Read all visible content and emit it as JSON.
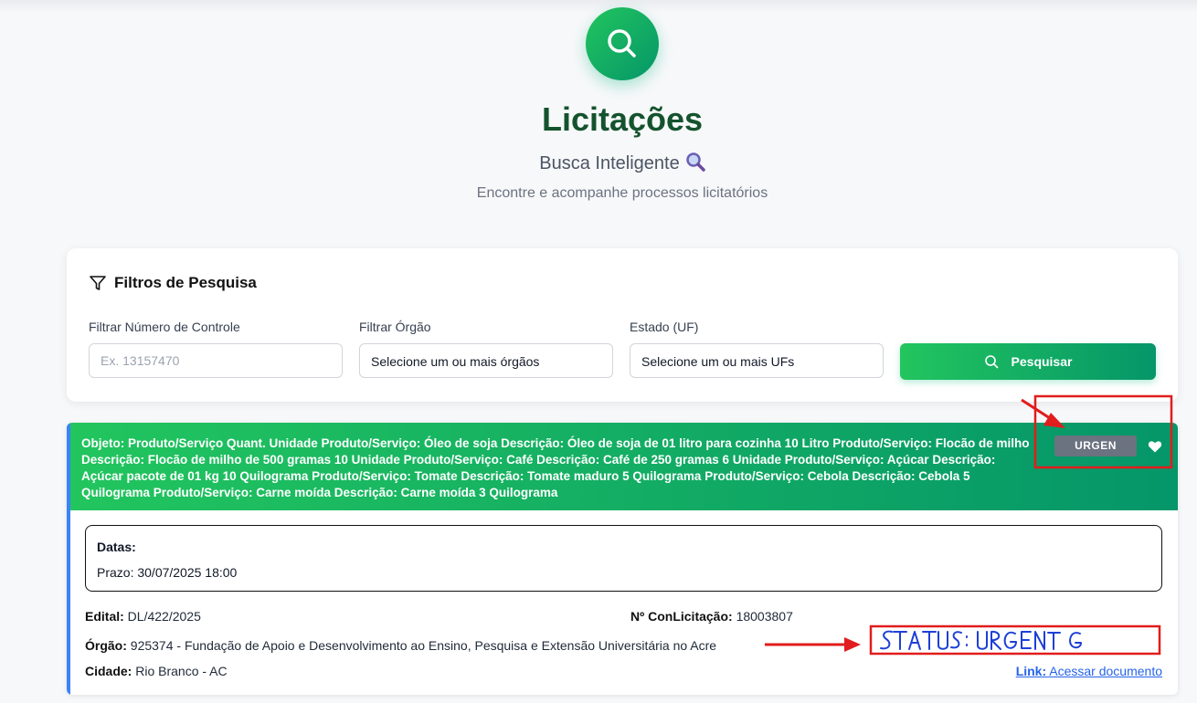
{
  "header": {
    "title": "Licitações",
    "subtitle": "Busca Inteligente",
    "description": "Encontre e acompanhe processos licitatórios"
  },
  "filters": {
    "title": "Filtros de Pesquisa",
    "controle_label": "Filtrar Número de Controle",
    "controle_placeholder": "Ex. 13157470",
    "orgao_label": "Filtrar Órgão",
    "orgao_value": "Selecione um ou mais órgãos",
    "uf_label": "Estado (UF)",
    "uf_value": "Selecione um ou mais UFs",
    "search_label": "Pesquisar"
  },
  "result": {
    "objeto_label": "Objeto:",
    "objeto_text": "Produto/Serviço Quant. Unidade Produto/Serviço: Óleo de soja Descrição: Óleo de soja de 01 litro para cozinha 10 Litro Produto/Serviço: Flocão de milho Descrição: Flocão de milho de 500 gramas 10 Unidade Produto/Serviço: Café Descrição: Café de 250 gramas 6 Unidade Produto/Serviço: Açúcar Descrição: Açúcar pacote de 01 kg 10 Quilograma Produto/Serviço: Tomate Descrição: Tomate maduro 5 Quilograma Produto/Serviço: Cebola Descrição: Cebola 5 Quilograma Produto/Serviço: Carne moída Descrição: Carne moída 3 Quilograma",
    "badge": "URGEN",
    "datas_label": "Datas:",
    "prazo": "Prazo: 30/07/2025 18:00",
    "edital_label": "Edital:",
    "edital_value": "DL/422/2025",
    "conlicitacao_label": "Nº ConLicitação:",
    "conlicitacao_value": "18003807",
    "orgao_label": "Órgão:",
    "orgao_value": "925374 - Fundação de Apoio e Desenvolvimento ao Ensino, Pesquisa e Extensão Universitária no Acre",
    "cidade_label": "Cidade:",
    "cidade_value": "Rio Branco - AC",
    "link_label": "Link:",
    "link_text": "Acessar documento"
  },
  "annotation": {
    "handwritten": "STATUS: URGENTE",
    "color": "#e11d1d"
  },
  "colors": {
    "brand_green": "#22c55e",
    "brand_green_dark": "#059669",
    "title_green": "#14532d",
    "badge_gray": "#6b7280",
    "accent_blue": "#3b82f6"
  }
}
